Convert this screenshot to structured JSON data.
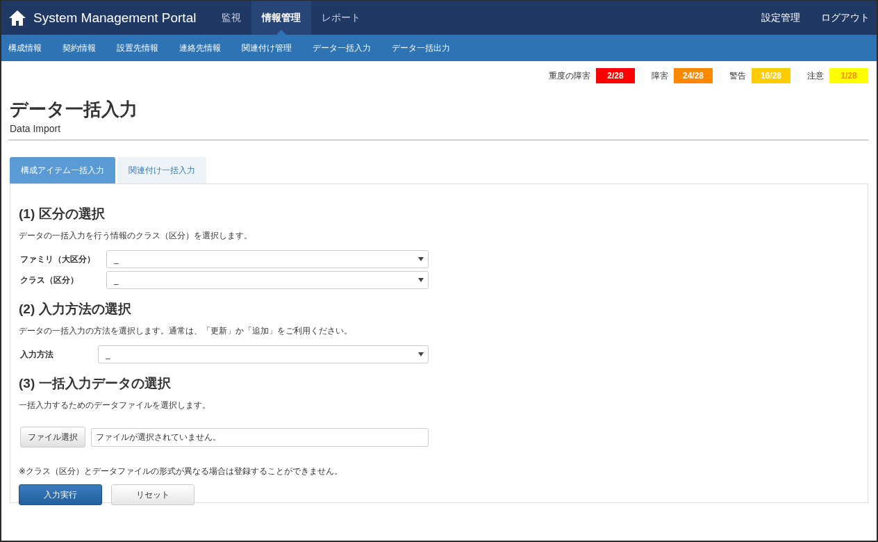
{
  "header": {
    "brand": "System Management Portal",
    "nav": [
      {
        "label": "監視",
        "selected": false
      },
      {
        "label": "情報管理",
        "selected": true
      },
      {
        "label": "レポート",
        "selected": false
      }
    ],
    "right_links": [
      "設定管理",
      "ログアウト"
    ]
  },
  "subnav": [
    "構成情報",
    "契約情報",
    "設置先情報",
    "連絡先情報",
    "関連付け管理",
    "データ一括入力",
    "データ一括出力"
  ],
  "status": [
    {
      "label": "重度の障害",
      "count": "2/28",
      "kind": "critical",
      "color": "#ff0000"
    },
    {
      "label": "障害",
      "count": "24/28",
      "kind": "error",
      "color": "#ff8800"
    },
    {
      "label": "警告",
      "count": "16/28",
      "kind": "warning",
      "color": "#ffcc00"
    },
    {
      "label": "注意",
      "count": "1/28",
      "kind": "caution",
      "color": "#ffff00"
    }
  ],
  "page": {
    "title": "データ一括入力",
    "subtitle": "Data Import"
  },
  "tabs": [
    {
      "label": "構成アイテム一括入力",
      "selected": true
    },
    {
      "label": "関連付け一括入力",
      "selected": false
    }
  ],
  "sections": [
    {
      "heading": "(1) 区分の選択",
      "description": "データの一括入力を行う情報のクラス（区分）を選択します。",
      "fields": [
        {
          "label": "ファミリ（大区分）",
          "value": "_"
        },
        {
          "label": "クラス（区分）",
          "value": "_"
        }
      ]
    },
    {
      "heading": "(2) 入力方法の選択",
      "description": "データの一括入力の方法を選択します。通常は、「更新」か「追加」をご利用ください。",
      "fields": [
        {
          "label": "入力方法",
          "value": "_"
        }
      ]
    },
    {
      "heading": "(3) 一括入力データの選択",
      "description": "一括入力するためのデータファイルを選択します。",
      "file": {
        "button": "ファイル選択",
        "value": "ファイルが選択されていません。"
      }
    }
  ],
  "note": "※クラス（区分）とデータファイルの形式が異なる場合は登録することができません。",
  "buttons": {
    "submit": "入力実行",
    "reset": "リセット"
  }
}
